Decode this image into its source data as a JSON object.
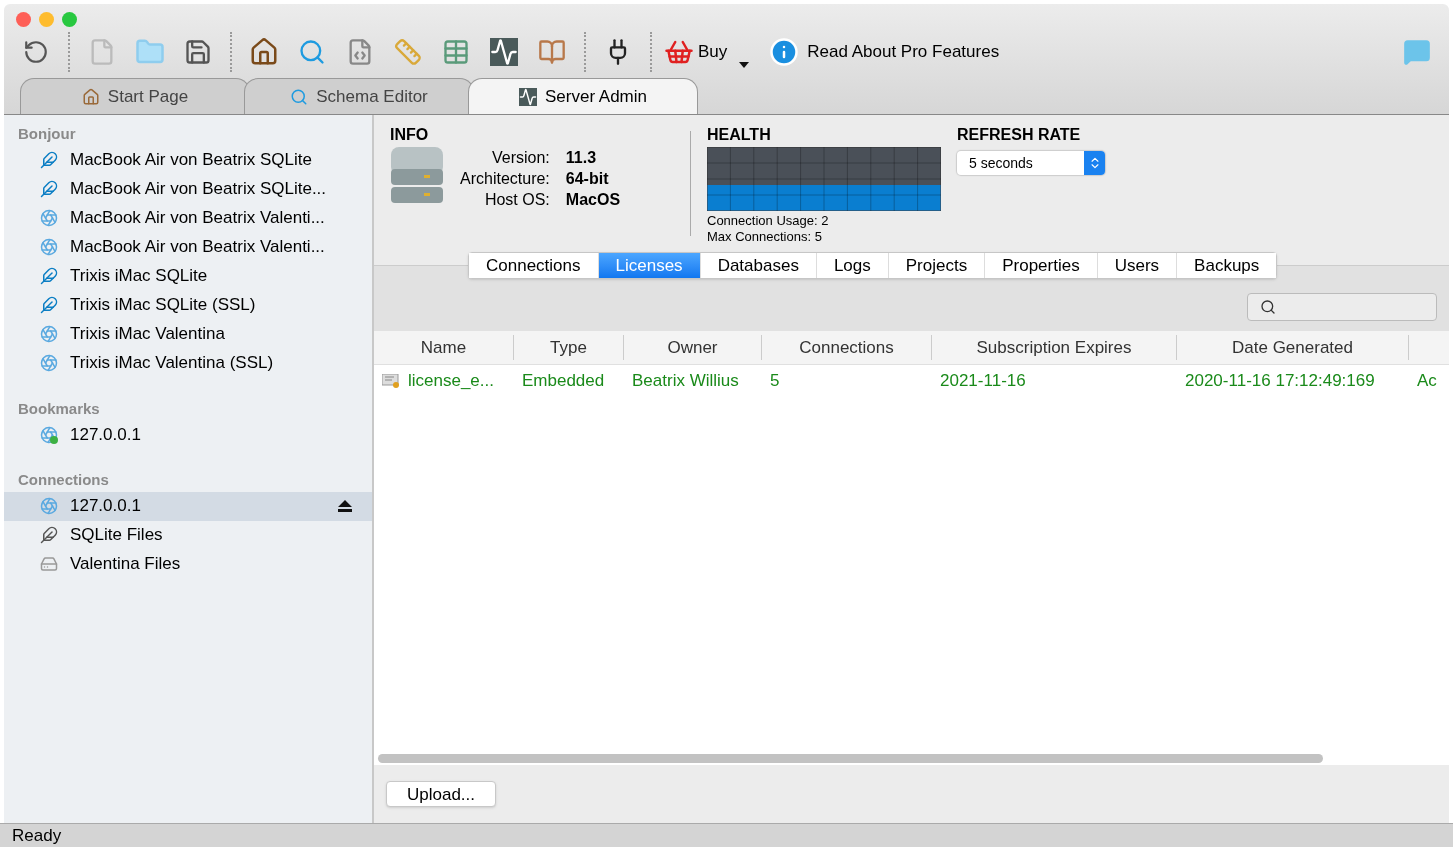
{
  "toolbar": {
    "buy_label": "Buy",
    "pro_label": "Read About Pro Features"
  },
  "tabs": [
    {
      "label": "Start Page",
      "selected": false
    },
    {
      "label": "Schema Editor",
      "selected": false
    },
    {
      "label": "Server Admin",
      "selected": true
    }
  ],
  "sidebar": {
    "sections": [
      {
        "title": "Bonjour",
        "items": [
          {
            "label": "MacBook Air von Beatrix SQLite",
            "kind": "sqlite",
            "selected": false
          },
          {
            "label": "MacBook Air von Beatrix SQLite...",
            "kind": "sqlite",
            "selected": false
          },
          {
            "label": "MacBook Air von Beatrix Valenti...",
            "kind": "valentina",
            "selected": false
          },
          {
            "label": "MacBook Air von Beatrix Valenti...",
            "kind": "valentina",
            "selected": false
          },
          {
            "label": "Trixis iMac SQLite",
            "kind": "sqlite",
            "selected": false
          },
          {
            "label": "Trixis iMac SQLite (SSL)",
            "kind": "sqlite",
            "selected": false
          },
          {
            "label": "Trixis iMac Valentina",
            "kind": "valentina",
            "selected": false
          },
          {
            "label": "Trixis iMac Valentina (SSL)",
            "kind": "valentina",
            "selected": false
          }
        ]
      },
      {
        "title": "Bookmarks",
        "items": [
          {
            "label": "127.0.0.1",
            "kind": "bookmark",
            "selected": false
          }
        ]
      },
      {
        "title": "Connections",
        "items": [
          {
            "label": "127.0.0.1",
            "kind": "connection",
            "selected": true
          },
          {
            "label": "SQLite Files",
            "kind": "sqlite-files",
            "selected": false
          },
          {
            "label": "Valentina Files",
            "kind": "files",
            "selected": false
          }
        ]
      }
    ]
  },
  "info": {
    "title": "INFO",
    "rows": [
      {
        "label": "Version:",
        "value": "11.3"
      },
      {
        "label": "Architecture:",
        "value": "64-bit"
      },
      {
        "label": "Host OS:",
        "value": "MacOS"
      }
    ]
  },
  "health": {
    "title": "HEALTH",
    "usage": "Connection Usage: 2",
    "max": "Max Connections: 5"
  },
  "refresh": {
    "title": "REFRESH RATE",
    "value": "5 seconds"
  },
  "subtabs": [
    {
      "label": "Connections",
      "selected": false
    },
    {
      "label": "Licenses",
      "selected": true
    },
    {
      "label": "Databases",
      "selected": false
    },
    {
      "label": "Logs",
      "selected": false
    },
    {
      "label": "Projects",
      "selected": false
    },
    {
      "label": "Properties",
      "selected": false
    },
    {
      "label": "Users",
      "selected": false
    },
    {
      "label": "Backups",
      "selected": false
    }
  ],
  "table": {
    "columns": [
      "Name",
      "Type",
      "Owner",
      "Connections",
      "Subscription Expires",
      "Date Generated"
    ],
    "rows": [
      [
        "license_e...",
        "Embedded",
        "Beatrix Willius",
        "5",
        "2021-11-16",
        "2020-11-16 17:12:49:169",
        "Ac"
      ]
    ]
  },
  "upload_button": "Upload...",
  "status_bar": "Ready"
}
